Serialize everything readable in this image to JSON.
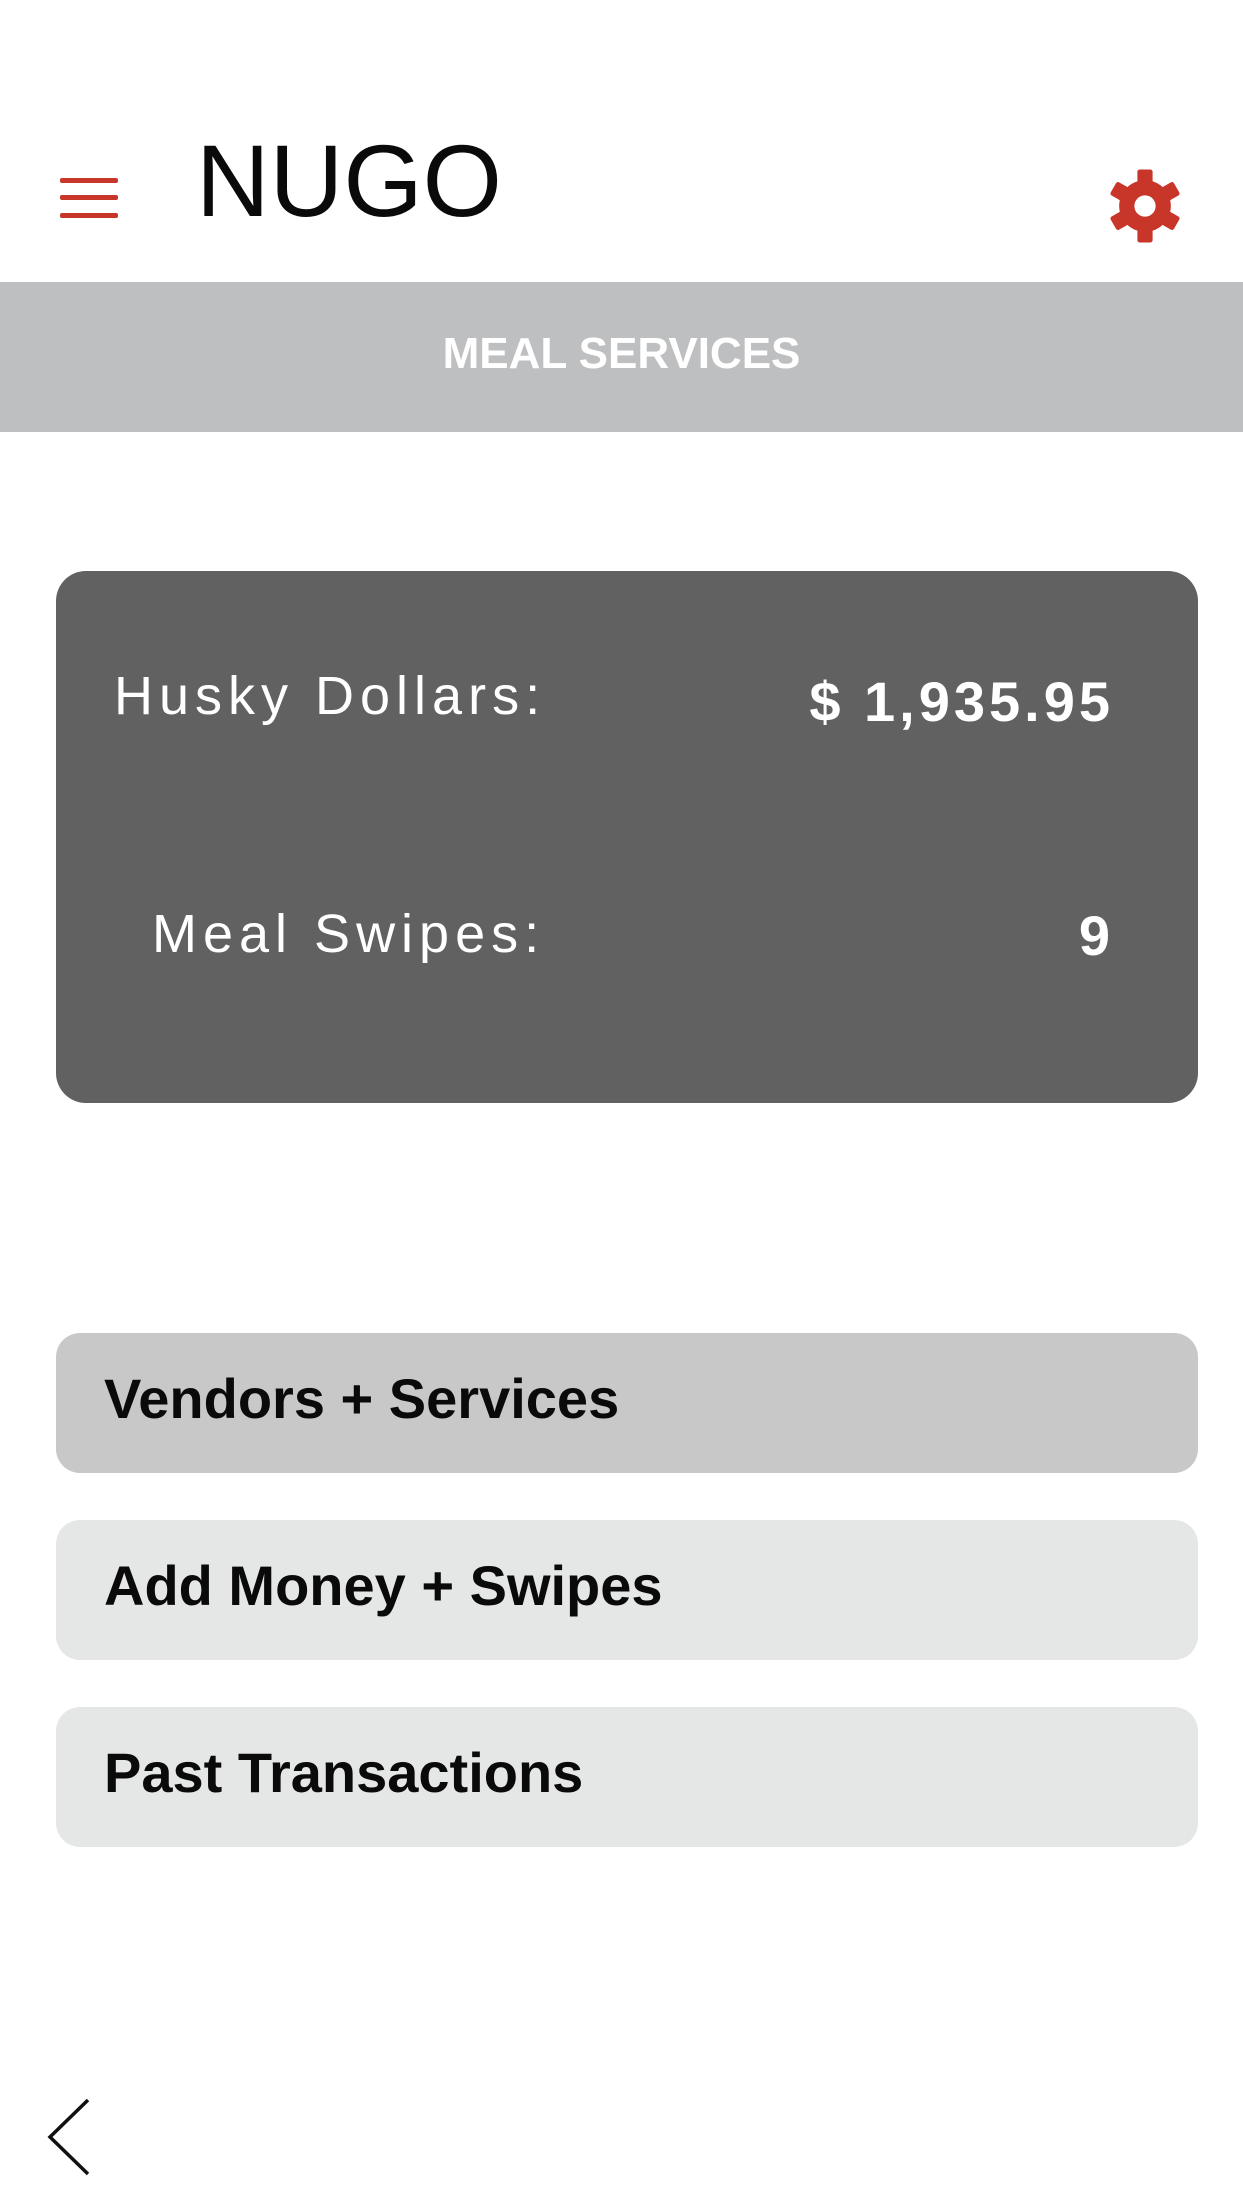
{
  "header": {
    "title": "NUGO",
    "menu_icon": "hamburger-menu-icon",
    "settings_icon": "gear-icon",
    "accent_color": "#c8362a"
  },
  "section": {
    "title": "MEAL SERVICES"
  },
  "balances": {
    "husky_dollars_label": "Husky Dollars:",
    "husky_dollars_value": "$ 1,935.95",
    "meal_swipes_label": "Meal Swipes:",
    "meal_swipes_value": "9"
  },
  "actions": [
    {
      "label": "Vendors + Services"
    },
    {
      "label": "Add Money + Swipes"
    },
    {
      "label": "Past Transactions"
    }
  ],
  "navigation": {
    "back_icon": "chevron-left-icon"
  }
}
